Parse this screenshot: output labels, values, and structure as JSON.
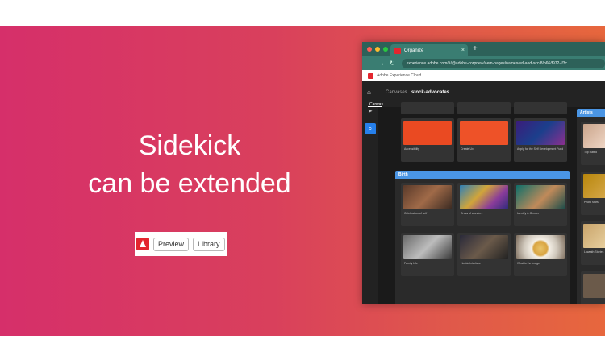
{
  "slide": {
    "headline_line1": "Sidekick",
    "headline_line2": "can be extended",
    "accent_color": "#d62f6a"
  },
  "sidekick": {
    "logo_icon": "adobe-icon",
    "preview_label": "Preview",
    "library_label": "Library"
  },
  "browser": {
    "tab_title": "Organize",
    "tab_close": "×",
    "new_tab": "+",
    "nav_icons": [
      "←",
      "→",
      "↻"
    ],
    "url": "experience.adobe.com/#/@adobe-corpnew/aem-pages/names/url-aed-xcc/8/b66/f972-f/3c",
    "header_title": "Adobe Experience Cloud",
    "breadcrumb_root": "Canvases",
    "breadcrumb_current": "stock-advocates",
    "canvas_tab": "Canvas",
    "home_icon": "⌂",
    "pointer_icon": "➤",
    "search_icon": "⌕"
  },
  "canvas": {
    "row1_labels": [
      "Accessibility",
      "Create Ux",
      "Apply for the Self Development Fund"
    ],
    "section_birth": "Birth",
    "row2_labels": [
      "Celebration of self",
      "Cross of wonders",
      "Identify & Gender"
    ],
    "row3_labels": [
      "Family Life",
      "Herbie Interface",
      "What is the image"
    ],
    "section_artists": "Artists",
    "right_labels": [
      "Top Rated",
      "Photo stars",
      "Lowrath Stories"
    ]
  }
}
